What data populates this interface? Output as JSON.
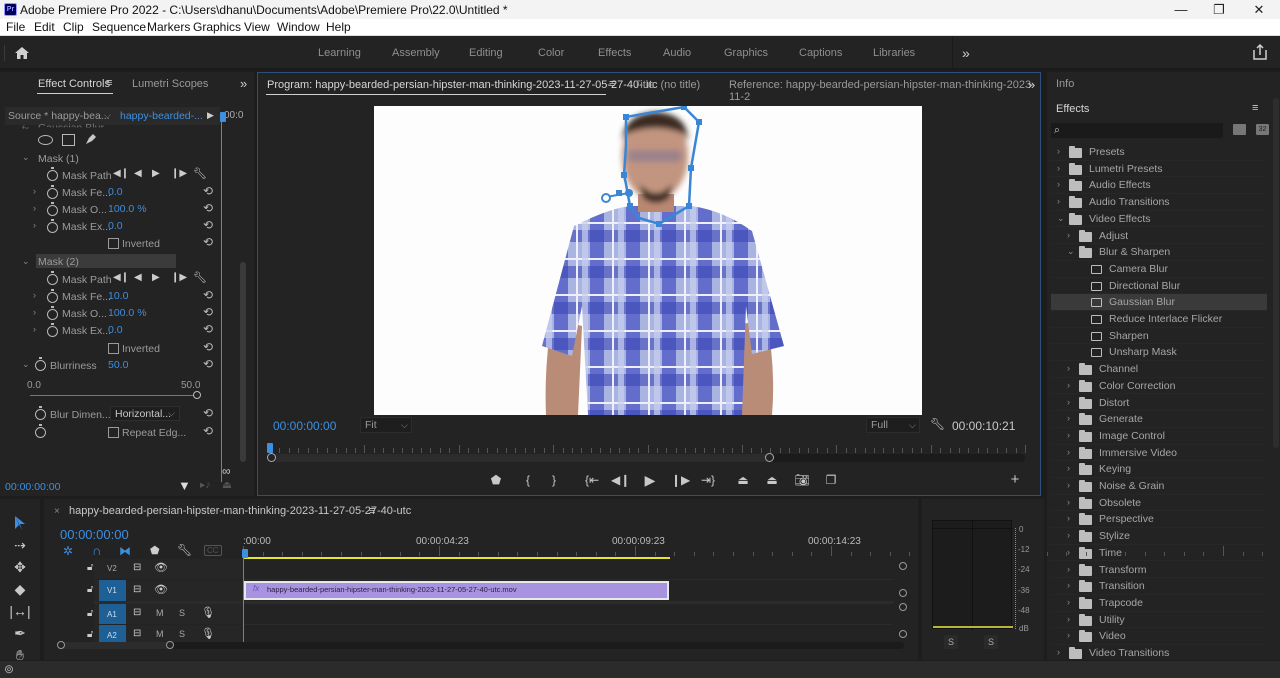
{
  "window": {
    "app_icon": "Pr",
    "title": "Adobe Premiere Pro 2022 - C:\\Users\\dhanu\\Documents\\Adobe\\Premiere Pro\\22.0\\Untitled *",
    "minimize": "—",
    "maximize": "❐",
    "close": "✕"
  },
  "menu": [
    "File",
    "Edit",
    "Clip",
    "Sequence",
    "Markers",
    "Graphics",
    "View",
    "Window",
    "Help"
  ],
  "workspaces": {
    "tabs": [
      "Learning",
      "Assembly",
      "Editing",
      "Color",
      "Effects",
      "Audio",
      "Graphics",
      "Captions",
      "Libraries"
    ],
    "more": "»",
    "home_icon": "home-icon",
    "share_icon": "share-icon"
  },
  "effect_controls": {
    "tab_active": "Effect Controls",
    "tab_menu": "≡",
    "tab_other": "Lumetri Scopes",
    "more": "»",
    "source_label": "Source * happy-bea...",
    "clip_label": "happy-bearded-...",
    "timeline_time": "00:0",
    "effect_name": "Gaussian Blur",
    "mask1": {
      "label": "Mask (1)",
      "path_label": "Mask Path",
      "feather_label": "Mask Fe...",
      "feather_value": "0.0",
      "opacity_label": "Mask O...",
      "opacity_value": "100.0 %",
      "expansion_label": "Mask Ex...",
      "expansion_value": "0.0",
      "inverted_label": "Inverted"
    },
    "mask2": {
      "label": "Mask (2)",
      "path_label": "Mask Path",
      "feather_label": "Mask Fe...",
      "feather_value": "10.0",
      "opacity_label": "Mask O...",
      "opacity_value": "100.0 %",
      "expansion_label": "Mask Ex...",
      "expansion_value": "0.0",
      "inverted_label": "Inverted"
    },
    "blurriness": {
      "label": "Blurriness",
      "value": "50.0",
      "slider_min": "0.0",
      "slider_max": "50.0",
      "slider_fraction": 1.0
    },
    "blur_dimensions": {
      "label": "Blur Dimen...",
      "value": "Horizontal..."
    },
    "repeat_edge": "Repeat Edg...",
    "timecode": "00:00:00:00"
  },
  "program_monitor": {
    "tab_program": "Program: happy-bearded-persian-hipster-man-thinking-2023-11-27-05-27-40-utc",
    "tab_menu": "≡",
    "tab_title": "Title: (no title)",
    "tab_reference": "Reference: happy-bearded-persian-hipster-man-thinking-2023-11-2",
    "more": "»",
    "timecode": "00:00:00:00",
    "zoom": "Fit",
    "resolution": "Full",
    "duration": "00:00:10:21",
    "playhead_fraction": 0.0,
    "add_button": "+"
  },
  "effects_panel": {
    "info_tab": "Info",
    "title": "Effects",
    "menu": "≡",
    "search_placeholder": "",
    "tree": [
      {
        "label": "Presets",
        "type": "preset-folder",
        "level": 0,
        "expanded": false
      },
      {
        "label": "Lumetri Presets",
        "type": "preset-folder",
        "level": 0,
        "expanded": false
      },
      {
        "label": "Audio Effects",
        "type": "folder",
        "level": 0,
        "expanded": false
      },
      {
        "label": "Audio Transitions",
        "type": "folder",
        "level": 0,
        "expanded": false
      },
      {
        "label": "Video Effects",
        "type": "folder",
        "level": 0,
        "expanded": true
      },
      {
        "label": "Adjust",
        "type": "folder",
        "level": 1,
        "expanded": false
      },
      {
        "label": "Blur & Sharpen",
        "type": "folder",
        "level": 1,
        "expanded": true
      },
      {
        "label": "Camera Blur",
        "type": "effect",
        "level": 2
      },
      {
        "label": "Directional Blur",
        "type": "effect",
        "level": 2
      },
      {
        "label": "Gaussian Blur",
        "type": "effect",
        "level": 2,
        "selected": true
      },
      {
        "label": "Reduce Interlace Flicker",
        "type": "effect",
        "level": 2
      },
      {
        "label": "Sharpen",
        "type": "effect",
        "level": 2
      },
      {
        "label": "Unsharp Mask",
        "type": "effect",
        "level": 2
      },
      {
        "label": "Channel",
        "type": "folder",
        "level": 1,
        "expanded": false
      },
      {
        "label": "Color Correction",
        "type": "folder",
        "level": 1,
        "expanded": false
      },
      {
        "label": "Distort",
        "type": "folder",
        "level": 1,
        "expanded": false
      },
      {
        "label": "Generate",
        "type": "folder",
        "level": 1,
        "expanded": false
      },
      {
        "label": "Image Control",
        "type": "folder",
        "level": 1,
        "expanded": false
      },
      {
        "label": "Immersive Video",
        "type": "folder",
        "level": 1,
        "expanded": false
      },
      {
        "label": "Keying",
        "type": "folder",
        "level": 1,
        "expanded": false
      },
      {
        "label": "Noise & Grain",
        "type": "folder",
        "level": 1,
        "expanded": false
      },
      {
        "label": "Obsolete",
        "type": "folder",
        "level": 1,
        "expanded": false
      },
      {
        "label": "Perspective",
        "type": "folder",
        "level": 1,
        "expanded": false
      },
      {
        "label": "Stylize",
        "type": "folder",
        "level": 1,
        "expanded": false
      },
      {
        "label": "Time",
        "type": "folder",
        "level": 1,
        "expanded": false
      },
      {
        "label": "Transform",
        "type": "folder",
        "level": 1,
        "expanded": false
      },
      {
        "label": "Transition",
        "type": "folder",
        "level": 1,
        "expanded": false
      },
      {
        "label": "Trapcode",
        "type": "folder",
        "level": 1,
        "expanded": false
      },
      {
        "label": "Utility",
        "type": "folder",
        "level": 1,
        "expanded": false
      },
      {
        "label": "Video",
        "type": "folder",
        "level": 1,
        "expanded": false
      },
      {
        "label": "Video Transitions",
        "type": "folder",
        "level": 0,
        "expanded": false
      }
    ]
  },
  "timeline": {
    "close": "×",
    "sequence_name": "happy-bearded-persian-hipster-man-thinking-2023-11-27-05-27-40-utc",
    "menu": "≡",
    "timecode": "00:00:00:00",
    "ruler_labels": [
      ":00:00",
      "00:00:04:23",
      "00:00:09:23",
      "00:00:14:23"
    ],
    "tracks": [
      {
        "name": "V2",
        "type": "video",
        "targeted": false
      },
      {
        "name": "V1",
        "type": "video",
        "targeted": true
      },
      {
        "name": "A1",
        "type": "audio",
        "targeted": true,
        "mute": "M",
        "solo": "S"
      },
      {
        "name": "A2",
        "type": "audio",
        "targeted": true,
        "mute": "M",
        "solo": "S"
      }
    ],
    "clip": {
      "label": "happy-bearded-persian-hipster-man-thinking-2023-11-27-05-27-40-utc.mov",
      "fx_badge": "fx",
      "color": "#a893e0"
    },
    "cc_label": "CC"
  },
  "audio_meter": {
    "scale": [
      "0",
      "-12",
      "-24",
      "-36",
      "-48",
      "dB"
    ],
    "solo_left": "S",
    "solo_right": "S"
  },
  "colors": {
    "accent_blue": "#3d8fe0",
    "panel_bg": "#232323",
    "clip_purple": "#a893e0",
    "work_area_yellow": "#e6e62e",
    "track_target_blue": "#1e5f95"
  }
}
